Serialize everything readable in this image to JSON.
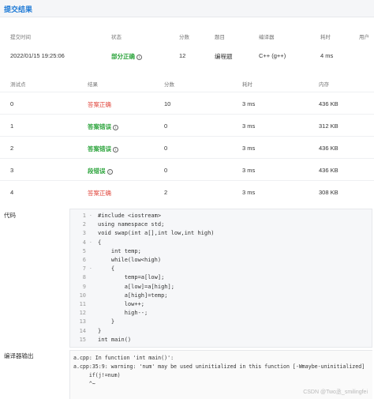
{
  "page_title": "提交结果",
  "submission": {
    "headers": [
      "提交时间",
      "状态",
      "分数",
      "题目",
      "编译器",
      "耗时",
      "用户"
    ],
    "time": "2022/01/15 19:25:06",
    "status": "部分正确",
    "score": "12",
    "problem": "编程题",
    "compiler": "C++ (g++)",
    "elapsed": "4 ms"
  },
  "testcases": {
    "headers": [
      "测试点",
      "结果",
      "分数",
      "耗时",
      "内存"
    ],
    "rows": [
      {
        "id": "0",
        "result": "答案正确",
        "result_color": "#e0453b",
        "has_info": false,
        "score": "10",
        "time": "3 ms",
        "memory": "436 KB"
      },
      {
        "id": "1",
        "result": "答案错误",
        "result_color": "#2aa33a",
        "has_info": true,
        "score": "0",
        "time": "3 ms",
        "memory": "312 KB"
      },
      {
        "id": "2",
        "result": "答案错误",
        "result_color": "#2aa33a",
        "has_info": true,
        "score": "0",
        "time": "3 ms",
        "memory": "436 KB"
      },
      {
        "id": "3",
        "result": "段错误",
        "result_color": "#2aa33a",
        "has_info": true,
        "score": "0",
        "time": "3 ms",
        "memory": "436 KB"
      },
      {
        "id": "4",
        "result": "答案正确",
        "result_color": "#e0453b",
        "has_info": false,
        "score": "2",
        "time": "3 ms",
        "memory": "308 KB"
      }
    ]
  },
  "code_section": {
    "label": "代码",
    "lines": [
      {
        "n": "1",
        "fold": "-",
        "text": "#include <iostream>"
      },
      {
        "n": "2",
        "fold": "",
        "text": "using namespace std;"
      },
      {
        "n": "3",
        "fold": "",
        "text": "void swap(int a[],int low,int high)"
      },
      {
        "n": "4",
        "fold": "-",
        "text": "{"
      },
      {
        "n": "5",
        "fold": "",
        "text": "    int temp;"
      },
      {
        "n": "6",
        "fold": "",
        "text": "    while(low<high)"
      },
      {
        "n": "7",
        "fold": "-",
        "text": "    {"
      },
      {
        "n": "8",
        "fold": "",
        "text": "        temp=a[low];"
      },
      {
        "n": "9",
        "fold": "",
        "text": "        a[low]=a[high];"
      },
      {
        "n": "10",
        "fold": "",
        "text": "        a[high]=temp;"
      },
      {
        "n": "11",
        "fold": "",
        "text": "        low++;"
      },
      {
        "n": "12",
        "fold": "",
        "text": "        high--;"
      },
      {
        "n": "13",
        "fold": "",
        "text": "    }"
      },
      {
        "n": "14",
        "fold": "",
        "text": "}"
      },
      {
        "n": "15",
        "fold": "",
        "text": "int main()"
      }
    ]
  },
  "compiler_section": {
    "label": "编译器输出",
    "lines": [
      "a.cpp: In function 'int main()':",
      "a.cpp:35:9: warning: 'num' may be used uninitialized in this function [-Wmaybe-uninitialized]",
      "     if(j!=num)",
      "     ^~"
    ]
  },
  "watermark": "CSDN @Two丞_smilingfei"
}
